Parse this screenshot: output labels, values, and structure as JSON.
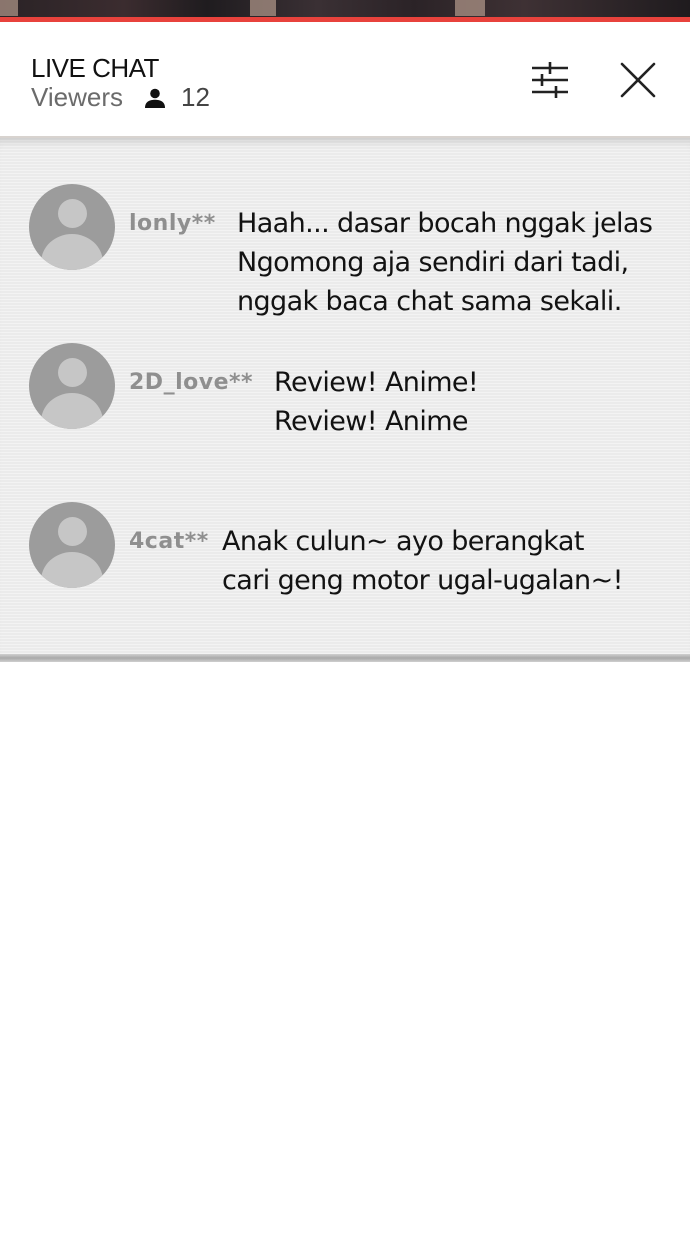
{
  "header": {
    "title": "LIVE CHAT",
    "viewers_label": "Viewers",
    "viewer_count": "12",
    "icons": {
      "viewers": "person-icon",
      "settings": "sliders-icon",
      "close": "close-icon"
    }
  },
  "colors": {
    "accent": "#e8423c",
    "panel_bg": "#efefef",
    "username": "#8f8f8f",
    "avatar": "#9c9c9c"
  },
  "messages": [
    {
      "username": "lonly**",
      "lines": [
        "Haah... dasar bocah nggak jelas",
        "Ngomong aja sendiri dari tadi,",
        "nggak baca chat sama sekali."
      ]
    },
    {
      "username": "2D_love**",
      "lines": [
        "Review! Anime!",
        "Review! Anime"
      ]
    },
    {
      "username": "4cat**",
      "lines": [
        "Anak culun~ ayo berangkat",
        "cari geng motor ugal-ugalan~!"
      ]
    }
  ]
}
